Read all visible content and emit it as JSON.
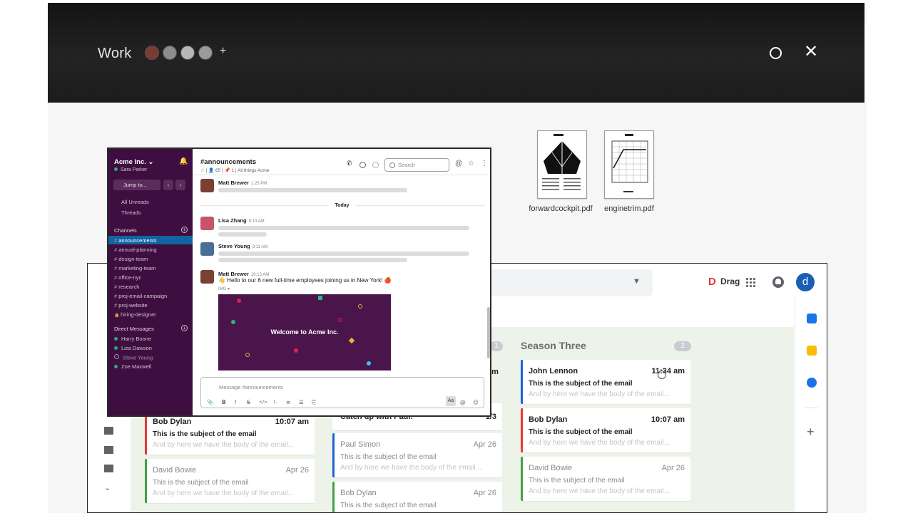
{
  "workspace": {
    "title": "Work",
    "add_label": "+"
  },
  "files": [
    {
      "name": "forwardcockpit.pdf"
    },
    {
      "name": "enginetrim.pdf"
    }
  ],
  "mail": {
    "drag_label": "Drag",
    "avatar_letter": "d",
    "columns": [
      {
        "title": "Season Three",
        "count": "2",
        "partial_count": "1"
      }
    ],
    "cards_left": [
      {
        "from": "Bob Dylan",
        "time": "10:07 am",
        "subject": "This is the subject of the email",
        "body": "And by here we have the body of the email...",
        "bar": "#e53935",
        "dim": false
      },
      {
        "from": "David Bowie",
        "time": "Apr 26",
        "subject": "This is the subject of the email",
        "body": "And by here we have the body of the email...",
        "bar": "#43a047",
        "dim": true
      }
    ],
    "cards_mid": [
      {
        "from": "Catch up with Paul.",
        "time": "1/3",
        "subject": "",
        "body": "",
        "bar": "#ffffff",
        "dim": false
      },
      {
        "from": "Paul Simon",
        "time": "Apr 26",
        "subject": "This is the subject of the email",
        "body": "And by here we have the body of the email...",
        "bar": "#1e63d6",
        "dim": true
      },
      {
        "from": "Bob Dylan",
        "time": "Apr 26",
        "subject": "This is the subject of the email",
        "body": "",
        "bar": "#43a047",
        "dim": true
      }
    ],
    "cards_right": [
      {
        "from": "John Lennon",
        "time": "11:34 am",
        "subject": "This is the subject of the email",
        "body": "And by here we have the body of the email...",
        "bar": "#1e63d6",
        "dim": false
      },
      {
        "from": "Bob Dylan",
        "time": "10:07 am",
        "subject": "This is the subject of the email",
        "body": "And by here we have the body of the email...",
        "bar": "#e53935",
        "dim": false
      },
      {
        "from": "David Bowie",
        "time": "Apr 26",
        "subject": "This is the subject of the email",
        "body": "And by here we have the body of the email...",
        "bar": "#43a047",
        "dim": true
      }
    ],
    "partial_time": "am"
  },
  "slack": {
    "workspace_name": "Acme Inc.",
    "workspace_caret": "⌄",
    "user": "Sara Parker",
    "jump_label": "Jump to...",
    "nav_back": "‹",
    "nav_forward": "›",
    "top_items": [
      "All Unreads",
      "Threads"
    ],
    "channels_title": "Channels",
    "channels": [
      "announcements",
      "annual-planning",
      "design-team",
      "marketing-team",
      "office-nyc",
      "research",
      "proj-email-campaign",
      "proj-website"
    ],
    "private_channel": "hiring-designer",
    "dm_title": "Direct Messages",
    "dms": [
      {
        "name": "Harry Boone",
        "online": true
      },
      {
        "name": "Liza Dawson",
        "online": true
      },
      {
        "name": "Steve Young",
        "online": false
      },
      {
        "name": "Zoe Maxwell",
        "online": true
      }
    ],
    "channel_title": "#announcements",
    "channel_meta": "☆  |  👤 65  |  📌 1  |  All things Acme",
    "search_placeholder": "Search",
    "today_label": "Today",
    "messages": [
      {
        "name": "Matt Brewer",
        "time": "1:25 PM"
      },
      {
        "name": "Lisa Zhang",
        "time": "9:10 AM"
      },
      {
        "name": "Steve Young",
        "time": "9:11 AM"
      },
      {
        "name": "Matt Brewer",
        "time": "10:13 AM"
      }
    ],
    "last_message_text": "👋 Hello to our 6 new full-time employees joining us in New York! 🍎",
    "image_label": "IMG ▾",
    "image_text": "Welcome to Acme Inc.",
    "composer_placeholder": "Message #announcements",
    "composer_tools": [
      "📎",
      "B",
      "I",
      "S",
      "</>",
      "1.",
      "≡",
      "☰",
      "⎘"
    ],
    "aa_label": "Aa",
    "at_label": "@",
    "emoji_label": "☺"
  },
  "colors": {
    "slack_sidebar": "#3f0e40",
    "slack_active": "#1264a3",
    "mail_accent": "#1a5fb4"
  }
}
